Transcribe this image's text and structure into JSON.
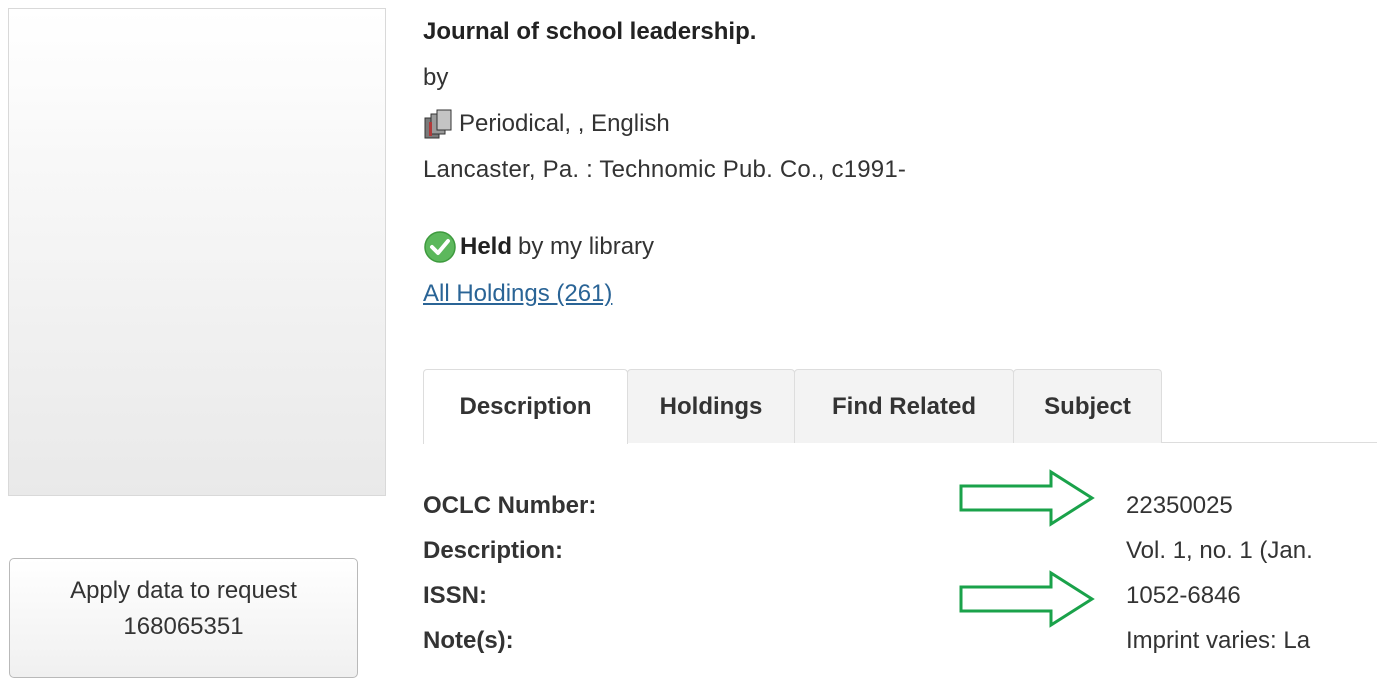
{
  "record": {
    "title": "Journal of school leadership.",
    "by": "by",
    "format": "Periodical, , English",
    "publisher": "Lancaster, Pa. : Technomic Pub. Co., c1991-",
    "held_bold": "Held",
    "held_rest": "by my library",
    "all_holdings": "All Holdings (261)"
  },
  "tabs": [
    {
      "label": "Description"
    },
    {
      "label": "Holdings"
    },
    {
      "label": "Find Related"
    },
    {
      "label": "Subject"
    }
  ],
  "fields": [
    {
      "label": "OCLC Number:",
      "value": "22350025"
    },
    {
      "label": "Description:",
      "value": "Vol. 1, no. 1 (Jan."
    },
    {
      "label": "ISSN:",
      "value": "1052-6846"
    },
    {
      "label": "Note(s):",
      "value": "Imprint varies: La"
    }
  ],
  "apply_button": {
    "line1": "Apply data to request",
    "line2": "168065351"
  },
  "colors": {
    "arrow": "#1aa24a",
    "link": "#2a6496",
    "check": "#5cb85c"
  },
  "icons": {
    "format": "periodical-stack-icon",
    "held": "green-check-icon"
  }
}
